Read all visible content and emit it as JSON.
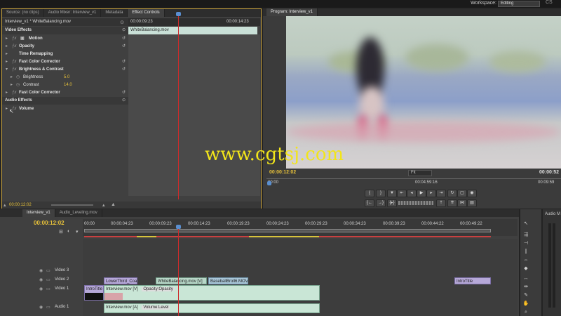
{
  "workspace": {
    "label": "Workspace:",
    "value": "Editing",
    "extra": "CS"
  },
  "left_panel": {
    "tabs": [
      "Source: (no clips)",
      "Audio Mixer: Interview_v1",
      "Metadata",
      "Effect Controls"
    ],
    "clip_title": "Interview_v1 * WhiteBalancing.mov",
    "ruler_start": "00:00:09:23",
    "ruler_end": "00:00:14:23",
    "clip_bar_label": "WhiteBalancing.mov",
    "sections": {
      "video": "Video Effects",
      "audio": "Audio Effects"
    },
    "effects": [
      {
        "name": "Motion"
      },
      {
        "name": "Opacity"
      },
      {
        "name": "Time Remapping"
      },
      {
        "name": "Fast Color Corrector"
      },
      {
        "name": "Brightness & Contrast"
      },
      {
        "name": "Brightness",
        "value": "5.0"
      },
      {
        "name": "Contrast",
        "value": "14.0"
      },
      {
        "name": "Fast Color Corrector"
      },
      {
        "name": "Volume"
      }
    ],
    "timecode": "00:00:12:02"
  },
  "program": {
    "tab": "Program: Interview_v1",
    "timecode": "00:00:12:02",
    "fit": "Fit",
    "duration": "00:00:52",
    "ruler": [
      "00:00",
      "00:04:59:16",
      "00:09:59"
    ]
  },
  "timeline": {
    "tabs": [
      "Interview_v1",
      "Audio_Leveling.mov"
    ],
    "timecode": "00:00:12:02",
    "ticks": [
      "00:00",
      "00:00:04:23",
      "00:00:09:23",
      "00:00:14:23",
      "00:00:19:23",
      "00:00:24:23",
      "00:00:29:23",
      "00:00:34:23",
      "00:00:39:23",
      "00:00:44:22",
      "00:00:49:22"
    ],
    "tracks": {
      "video3": "Video 3",
      "video2": "Video 2",
      "video1": "Video 1",
      "audio1": "Audio 1"
    },
    "clips": {
      "lower_third": "LowerThird_Coa",
      "white_balancing": "WhiteBalancing.mov [V]",
      "baseball": "BaseballBroll6.MOV",
      "intro_title_v2": "IntroTitle",
      "intro_title_v1": "IntroTitle",
      "interview_v": "Interview.mov [V]",
      "opacity": "Opacity:Opacity",
      "interview_a": "Interview.mov [A]",
      "volume": "Volume:Level"
    }
  },
  "audio_panel": {
    "label": "Audio M"
  },
  "watermark": "www.cgtsj.com",
  "colors": {
    "accent": "#e8c23a",
    "playhead": "#cc2b2b",
    "panel_border": "#c8a23c"
  }
}
